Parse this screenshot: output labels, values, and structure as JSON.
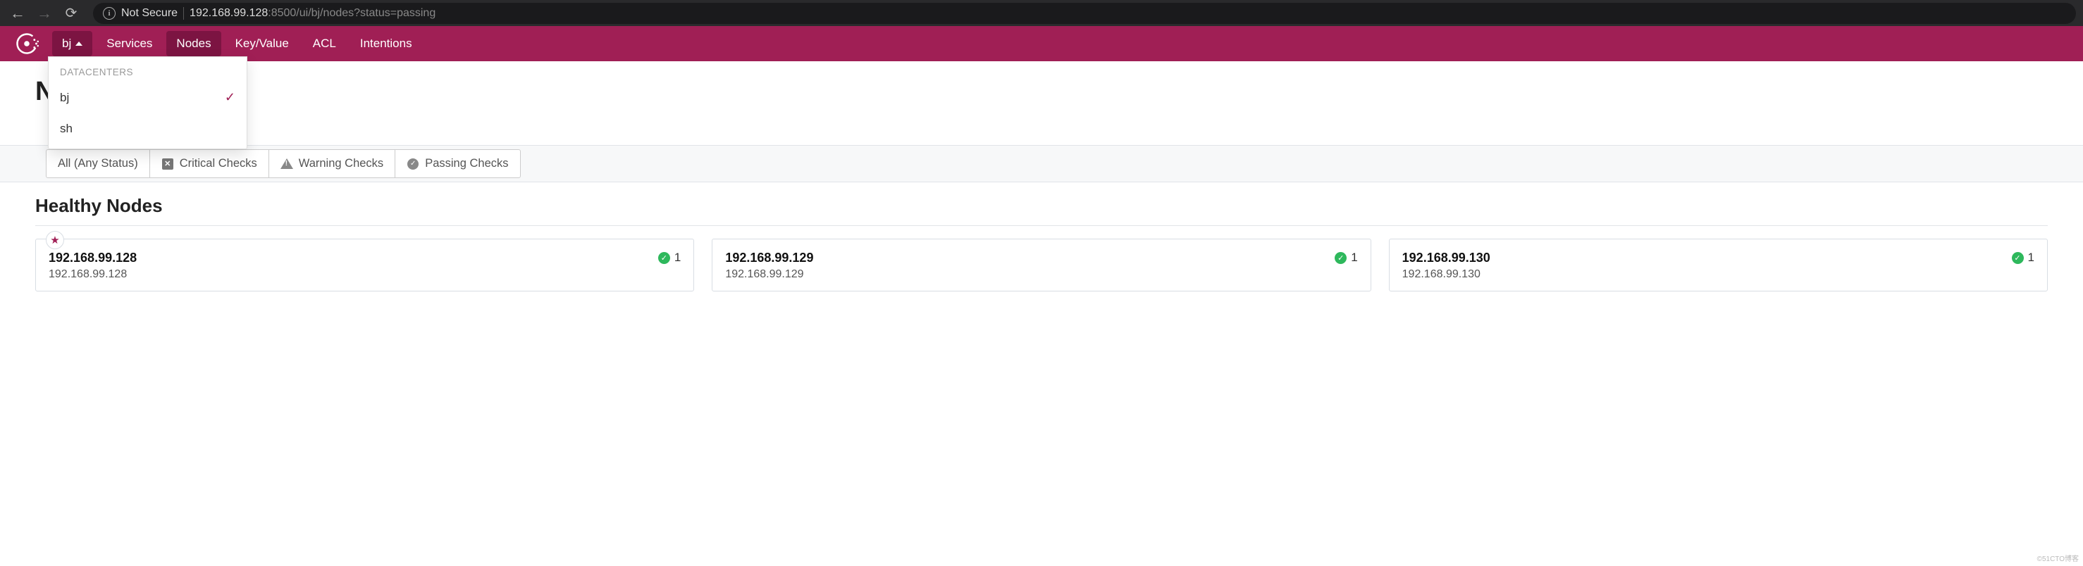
{
  "browser": {
    "not_secure": "Not Secure",
    "url_host": "192.168.99.128",
    "url_path": ":8500/ui/bj/nodes?status=passing"
  },
  "nav": {
    "datacenter_label": "bj",
    "items": {
      "services": "Services",
      "nodes": "Nodes",
      "keyvalue": "Key/Value",
      "acl": "ACL",
      "intentions": "Intentions"
    }
  },
  "dropdown": {
    "header": "DATACENTERS",
    "items": [
      {
        "label": "bj",
        "selected": true
      },
      {
        "label": "sh",
        "selected": false
      }
    ]
  },
  "page": {
    "title_visible": "N",
    "filters": {
      "all": "All (Any Status)",
      "critical": "Critical Checks",
      "warning": "Warning Checks",
      "passing": "Passing Checks"
    },
    "section_title": "Healthy Nodes",
    "nodes": [
      {
        "name": "192.168.99.128",
        "addr": "192.168.99.128",
        "count": "1",
        "starred": true
      },
      {
        "name": "192.168.99.129",
        "addr": "192.168.99.129",
        "count": "1",
        "starred": false
      },
      {
        "name": "192.168.99.130",
        "addr": "192.168.99.130",
        "count": "1",
        "starred": false
      }
    ]
  },
  "watermark": "©51CTO博客"
}
